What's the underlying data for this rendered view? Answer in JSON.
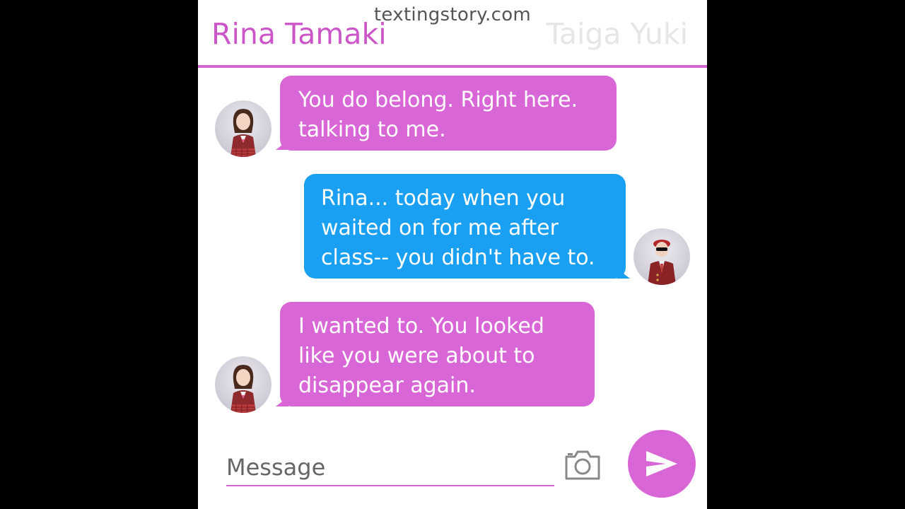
{
  "watermark": "textingstory.com",
  "header": {
    "left_name": "Rina Tamaki",
    "right_name": "Taiga Yuki"
  },
  "messages": [
    {
      "sender": "Rina Tamaki",
      "direction": "incoming",
      "text": "You do belong. Right here.\ntalking to me."
    },
    {
      "sender": "Taiga Yuki",
      "direction": "outgoing",
      "text": "Rina... today when you\nwaited on for me after\nclass-- you didn't have to."
    },
    {
      "sender": "Rina Tamaki",
      "direction": "incoming",
      "text": "I wanted to.  You looked\nlike you were about to\ndisappear again."
    }
  ],
  "composer": {
    "placeholder": "Message",
    "camera_icon": "camera-icon",
    "send_icon": "send-icon"
  },
  "colors": {
    "accent": "#d466d4",
    "incoming_bubble": "#d966d6",
    "outgoing_bubble": "#1aa0f2",
    "right_name": "#e6e6e6"
  }
}
